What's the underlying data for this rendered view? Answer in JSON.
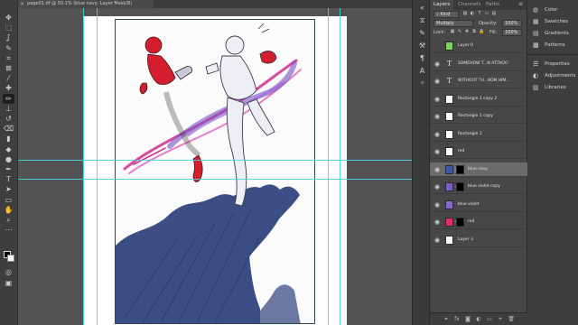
{
  "document": {
    "tab_title": "page01.tif @ 50.1% (blue navy, Layer Mask/8)"
  },
  "toolbar": {
    "tools": [
      {
        "name": "move-tool-icon",
        "glyph": "✥"
      },
      {
        "name": "marquee-tool-icon",
        "glyph": "⬚"
      },
      {
        "name": "lasso-tool-icon",
        "glyph": "ʆ"
      },
      {
        "name": "quick-select-tool-icon",
        "glyph": "✎"
      },
      {
        "name": "crop-tool-icon",
        "glyph": "⌗"
      },
      {
        "name": "frame-tool-icon",
        "glyph": "⊠"
      },
      {
        "name": "eyedropper-tool-icon",
        "glyph": "⁄"
      },
      {
        "name": "healing-brush-tool-icon",
        "glyph": "✚"
      },
      {
        "name": "brush-tool-icon",
        "glyph": "✏"
      },
      {
        "name": "clone-stamp-tool-icon",
        "glyph": "⊥"
      },
      {
        "name": "history-brush-tool-icon",
        "glyph": "↺"
      },
      {
        "name": "eraser-tool-icon",
        "glyph": "⌫"
      },
      {
        "name": "gradient-tool-icon",
        "glyph": "▮"
      },
      {
        "name": "blur-tool-icon",
        "glyph": "◆"
      },
      {
        "name": "dodge-tool-icon",
        "glyph": "●"
      },
      {
        "name": "pen-tool-icon",
        "glyph": "✒"
      },
      {
        "name": "type-tool-icon",
        "glyph": "T"
      },
      {
        "name": "path-select-tool-icon",
        "glyph": "➤"
      },
      {
        "name": "shape-tool-icon",
        "glyph": "▭"
      },
      {
        "name": "hand-tool-icon",
        "glyph": "✋"
      },
      {
        "name": "zoom-tool-icon",
        "glyph": "⌕"
      },
      {
        "name": "more-tools-icon",
        "glyph": "⋯"
      }
    ],
    "bottom_tools": [
      {
        "name": "quick-mask-icon",
        "glyph": "◎"
      },
      {
        "name": "screen-mode-icon",
        "glyph": "▣"
      }
    ]
  },
  "dock": {
    "icons": [
      {
        "name": "collapse-arrows-icon",
        "glyph": "«"
      },
      {
        "name": "history-panel-icon",
        "glyph": "⧖"
      },
      {
        "name": "brush-settings-icon",
        "glyph": "✎"
      },
      {
        "name": "tool-presets-icon",
        "glyph": "⚒"
      },
      {
        "name": "paragraph-icon",
        "glyph": "¶"
      },
      {
        "name": "character-icon",
        "glyph": "A"
      },
      {
        "name": "glyphs-icon",
        "glyph": "ᵃ"
      }
    ]
  },
  "layers_panel": {
    "tabs": [
      "Layers",
      "Channels",
      "Paths"
    ],
    "active_tab": "Layers",
    "menu_glyph": "≡",
    "filter": {
      "label": "Kind",
      "icons": [
        "▧",
        "◐",
        "T",
        "▭",
        "▤"
      ]
    },
    "blend_mode": "Multiply",
    "opacity": {
      "label": "Opacity:",
      "value": "100%"
    },
    "lock": {
      "label": "Lock:",
      "icons": [
        "▦",
        "✎",
        "✥",
        "⧉",
        "🔒"
      ]
    },
    "fill": {
      "label": "Fill:",
      "value": "100%"
    },
    "layers": [
      {
        "name": "Layer 0",
        "kind": "pixel",
        "thumb_color": "#7dd35a",
        "visible": false,
        "selected": false
      },
      {
        "name": "SOMEHOW T...N ATTACK!",
        "kind": "type",
        "visible": true,
        "selected": false
      },
      {
        "name": "WITHOUT TH...BON HIM...",
        "kind": "type",
        "visible": true,
        "selected": false
      },
      {
        "name": "Rectangle 1 copy 2",
        "kind": "pixel",
        "thumb_color": "#ffffff",
        "visible": true,
        "selected": false
      },
      {
        "name": "Rectangle 1 copy",
        "kind": "pixel",
        "thumb_color": "#ffffff",
        "visible": true,
        "selected": false
      },
      {
        "name": "Rectangle 1",
        "kind": "pixel",
        "thumb_color": "#ffffff",
        "visible": true,
        "selected": false
      },
      {
        "name": "red",
        "kind": "pixel",
        "thumb_color": "#ffffff",
        "visible": true,
        "selected": false
      },
      {
        "name": "blue navy",
        "kind": "masked",
        "thumb_color": "#3c5aa8",
        "visible": true,
        "selected": true
      },
      {
        "name": "blue violet copy",
        "kind": "masked",
        "thumb_color": "#7d5fc8",
        "visible": true,
        "selected": false
      },
      {
        "name": "blue violet",
        "kind": "pixel",
        "thumb_color": "#8a6ad0",
        "visible": true,
        "selected": false
      },
      {
        "name": "red",
        "kind": "masked",
        "thumb_color": "#e0306a",
        "visible": true,
        "selected": false
      },
      {
        "name": "Layer 3",
        "kind": "pixel",
        "thumb_color": "#ffffff",
        "visible": true,
        "selected": false
      }
    ],
    "footer_icons": [
      {
        "name": "link-layers-icon",
        "glyph": "⚭"
      },
      {
        "name": "layer-style-icon",
        "glyph": "fx"
      },
      {
        "name": "add-mask-icon",
        "glyph": "◙"
      },
      {
        "name": "adjustment-layer-icon",
        "glyph": "◐"
      },
      {
        "name": "new-group-icon",
        "glyph": "▭"
      },
      {
        "name": "new-layer-icon",
        "glyph": "+"
      },
      {
        "name": "delete-layer-icon",
        "glyph": "🗑"
      }
    ]
  },
  "side_panels": {
    "groups": [
      [
        {
          "label": "Color",
          "icon": "◍"
        },
        {
          "label": "Swatches",
          "icon": "▦"
        },
        {
          "label": "Gradients",
          "icon": "▤"
        },
        {
          "label": "Patterns",
          "icon": "▩"
        }
      ],
      [
        {
          "label": "Properties",
          "icon": "☰"
        },
        {
          "label": "Adjustments",
          "icon": "◐"
        },
        {
          "label": "Libraries",
          "icon": "▥"
        }
      ]
    ]
  },
  "colors": {
    "guide": "#43d4e6",
    "navy": "#2b3f7a",
    "violet": "#6c4fb3",
    "magenta": "#d0208a",
    "red": "#d41e2d"
  }
}
